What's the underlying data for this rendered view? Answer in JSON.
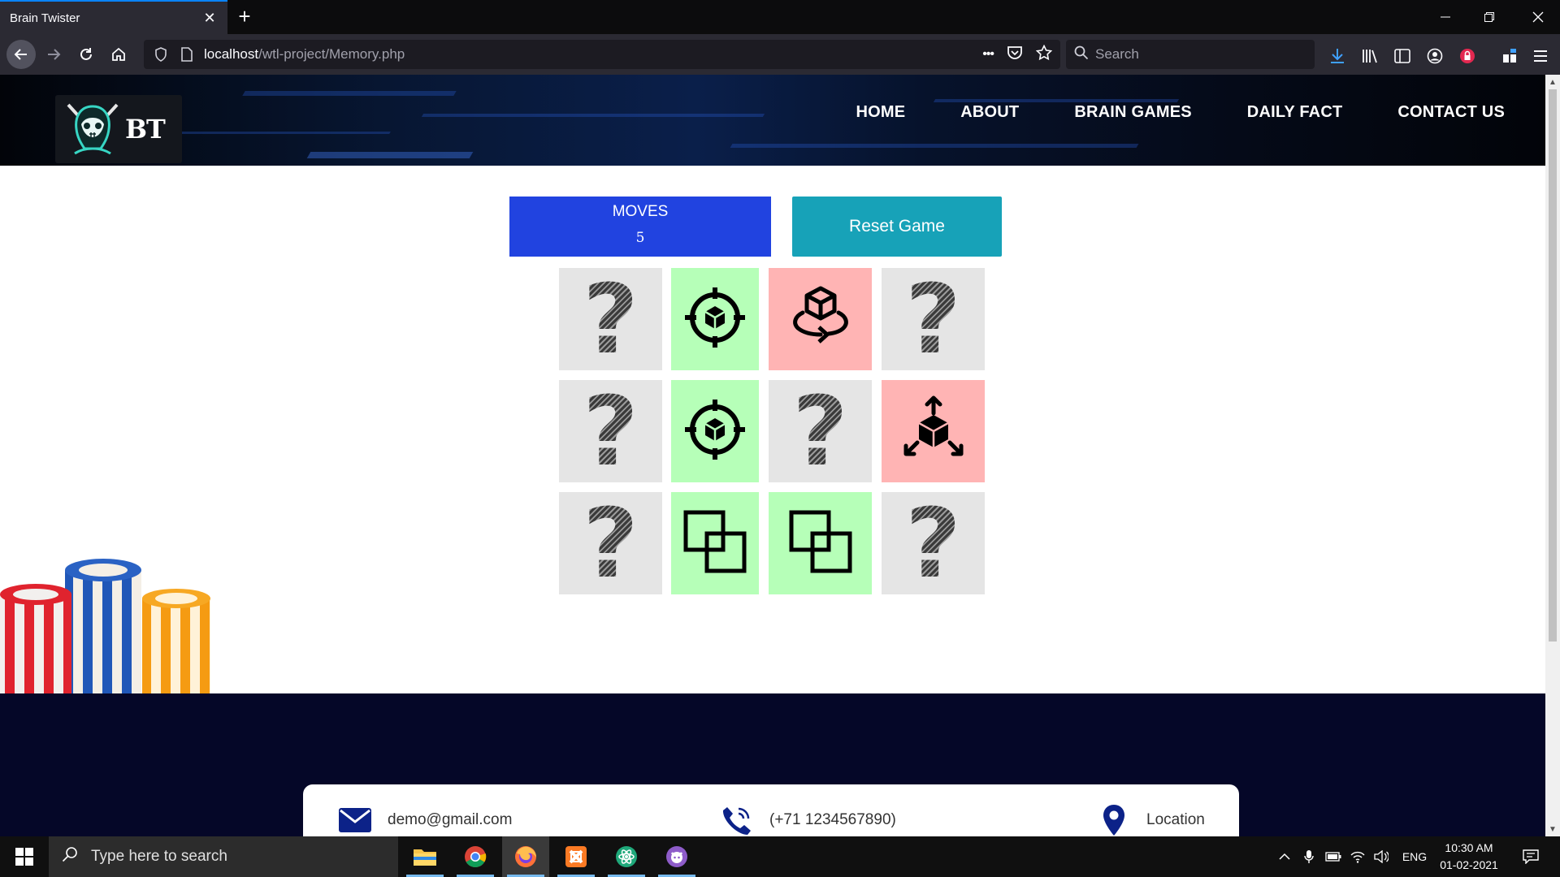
{
  "browser": {
    "tab_title": "Brain Twister",
    "tab_close": "✕",
    "new_tab": "+",
    "url_host": "localhost",
    "url_path": "/wtl-project/Memory.php",
    "search_placeholder": "Search",
    "url_more": "•••"
  },
  "site": {
    "logo_text": "BT",
    "nav": [
      "HOME",
      "ABOUT",
      "BRAIN GAMES",
      "DAILY FACT",
      "CONTACT US"
    ]
  },
  "game": {
    "moves_label": "MOVES",
    "moves": "5",
    "reset_label": "Reset Game",
    "cards": [
      {
        "state": "hidden",
        "icon": "question-mark",
        "text": "?"
      },
      {
        "state": "matched",
        "icon": "target-cube-icon",
        "text": ""
      },
      {
        "state": "mismatched",
        "icon": "rotate-cube-icon",
        "text": ""
      },
      {
        "state": "hidden",
        "icon": "question-mark",
        "text": "?"
      },
      {
        "state": "hidden",
        "icon": "question-mark",
        "text": "?"
      },
      {
        "state": "matched",
        "icon": "target-cube-icon",
        "text": ""
      },
      {
        "state": "hidden",
        "icon": "question-mark",
        "text": "?"
      },
      {
        "state": "mismatched",
        "icon": "cube-arrows-icon",
        "text": ""
      },
      {
        "state": "hidden",
        "icon": "question-mark",
        "text": "?"
      },
      {
        "state": "matched",
        "icon": "overlap-squares-icon",
        "text": ""
      },
      {
        "state": "matched",
        "icon": "overlap-squares-icon",
        "text": ""
      },
      {
        "state": "hidden",
        "icon": "question-mark",
        "text": "?"
      }
    ],
    "colors": {
      "hidden": "#e5e5e5",
      "matched": "#b6ffb8",
      "mismatched": "#ffb4b4",
      "moves_bg": "#2143e0",
      "reset_bg": "#17a2b8"
    }
  },
  "footer": {
    "email": "demo@gmail.com",
    "phone": "(+71 1234567890)",
    "location": "Location"
  },
  "taskbar": {
    "search_placeholder": "Type here to search",
    "language": "ENG",
    "time": "10:30 AM",
    "date": "01-02-2021"
  }
}
